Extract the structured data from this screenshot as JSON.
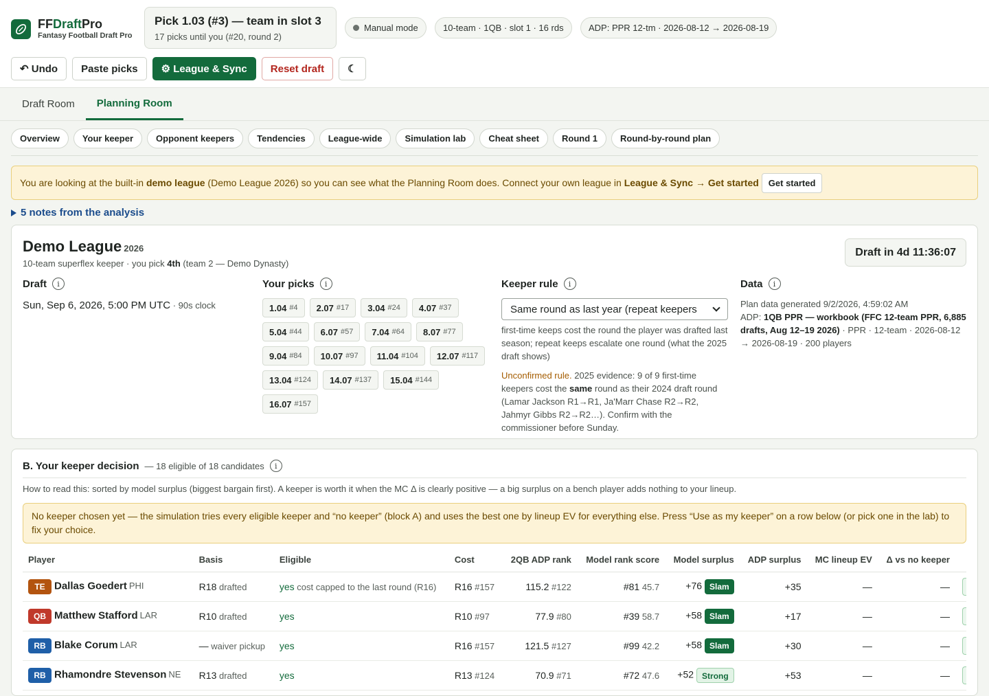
{
  "brand": {
    "name_a": "FF",
    "name_b": "Draft",
    "name_c": "Pro",
    "subtitle": "Fantasy Football Draft Pro"
  },
  "pick": {
    "title": "Pick 1.03 (#3) — team in slot 3",
    "subtitle": "17 picks until you (#20, round 2)"
  },
  "chips": {
    "mode": "Manual mode",
    "league": "10-team · 1QB · slot 1 · 16 rds",
    "adp": "ADP: PPR 12-tm · 2026-08-12 → 2026-08-19"
  },
  "toolbar": {
    "undo": "↶ Undo",
    "paste": "Paste picks",
    "league_sync": "⚙ League & Sync",
    "reset": "Reset draft",
    "theme": "☾"
  },
  "tabs": [
    "Draft Room",
    "Planning Room"
  ],
  "subtabs": [
    "Overview",
    "Your keeper",
    "Opponent keepers",
    "Tendencies",
    "League-wide",
    "Simulation lab",
    "Cheat sheet",
    "Round 1",
    "Round-by-round plan"
  ],
  "banner": {
    "t1": "You are looking at the built-in ",
    "b1": "demo league",
    "t2": " (Demo League 2026) so you can see what the Planning Room does. Connect your own league in ",
    "b2": "League & Sync",
    "t3": " → ",
    "b3": "Get started",
    "button": "Get started"
  },
  "notes": "5 notes from the analysis",
  "league": {
    "title": "Demo League",
    "year": "2026",
    "sub_a": "10-team superflex keeper · you pick ",
    "sub_b": "4th",
    "sub_c": " (team 2 — Demo Dynasty)",
    "countdown": "Draft in 4d 11:36:07",
    "draft_label": "Draft",
    "draft_date": "Sun, Sep 6, 2026, 5:00 PM UTC",
    "draft_clock": " · 90s clock",
    "picks_label": "Your picks",
    "picks": [
      {
        "p": "1.04",
        "n": "#4"
      },
      {
        "p": "2.07",
        "n": "#17"
      },
      {
        "p": "3.04",
        "n": "#24"
      },
      {
        "p": "4.07",
        "n": "#37"
      },
      {
        "p": "5.04",
        "n": "#44"
      },
      {
        "p": "6.07",
        "n": "#57"
      },
      {
        "p": "7.04",
        "n": "#64"
      },
      {
        "p": "8.07",
        "n": "#77"
      },
      {
        "p": "9.04",
        "n": "#84"
      },
      {
        "p": "10.07",
        "n": "#97"
      },
      {
        "p": "11.04",
        "n": "#104"
      },
      {
        "p": "12.07",
        "n": "#117"
      },
      {
        "p": "13.04",
        "n": "#124"
      },
      {
        "p": "14.07",
        "n": "#137"
      },
      {
        "p": "15.04",
        "n": "#144"
      },
      {
        "p": "16.07",
        "n": "#157"
      }
    ],
    "keeper_label": "Keeper rule",
    "keeper_select": "Same round as last year (repeat keepers",
    "keeper_desc": "first-time keeps cost the round the player was drafted last season; repeat keeps escalate one round (what the 2025 draft shows)",
    "unconf_a": "Unconfirmed rule.",
    "unconf_b": " 2025 evidence: 9 of 9 first-time keepers cost the ",
    "unconf_c": "same",
    "unconf_d": " round as their 2024 draft round (Lamar Jackson R1→R1, Ja'Marr Chase R2→R2, Jahmyr Gibbs R2→R2…). Confirm with the commissioner before Sunday.",
    "data_label": "Data",
    "data_a": "Plan data generated 9/2/2026, 4:59:02 AM",
    "data_b": "ADP: ",
    "data_c": "1QB PPR — workbook (FFC 12-team PPR, 6,885 drafts, Aug 12–19 2026)",
    "data_d": " · PPR · 12-team · 2026-08-12 → 2026-08-19 · 200 players"
  },
  "keeper": {
    "title": "B. Your keeper decision",
    "count": "— 18 eligible of 18 candidates",
    "howto": "How to read this: sorted by model surplus (biggest bargain first). A keeper is worth it when the MC Δ is clearly positive — a big surplus on a bench player adds nothing to your lineup.",
    "warn": "No keeper chosen yet — the simulation tries every eligible keeper and “no keeper” (block A) and uses the best one by lineup EV for everything else. Press “Use as my keeper” on a row below (or pick one in the lab) to fix your choice.",
    "headers": [
      "Player",
      "Basis",
      "Eligible",
      "Cost",
      "2QB ADP rank",
      "Model rank score",
      "Model surplus",
      "ADP surplus",
      "MC lineup EV",
      "Δ vs no keeper"
    ],
    "rows": [
      {
        "pos": "TE",
        "color": "#b3540f",
        "name": "Dallas Goedert",
        "team": "PHI",
        "basis": "R18",
        "basis_s": " drafted",
        "elig": "yes",
        "elig_s": " cost capped to the last round (R16)",
        "cost": "R16",
        "cost_s": " #157",
        "adp": "115.2",
        "adp_s": " #122",
        "mrank": "#81",
        "mrank_s": " 45.7",
        "surplus": "+76",
        "tag": "Slam",
        "tagc": "slam",
        "adps": "+35",
        "ev": "—",
        "delta": "—"
      },
      {
        "pos": "QB",
        "color": "#c0392b",
        "name": "Matthew Stafford",
        "team": "LAR",
        "basis": "R10",
        "basis_s": " drafted",
        "elig": "yes",
        "elig_s": "",
        "cost": "R10",
        "cost_s": " #97",
        "adp": "77.9",
        "adp_s": " #80",
        "mrank": "#39",
        "mrank_s": " 58.7",
        "surplus": "+58",
        "tag": "Slam",
        "tagc": "slam",
        "adps": "+17",
        "ev": "—",
        "delta": "—"
      },
      {
        "pos": "RB",
        "color": "#1f5fa8",
        "name": "Blake Corum",
        "team": "LAR",
        "basis": "—",
        "basis_s": " waiver pickup",
        "elig": "yes",
        "elig_s": "",
        "cost": "R16",
        "cost_s": " #157",
        "adp": "121.5",
        "adp_s": " #127",
        "mrank": "#99",
        "mrank_s": " 42.2",
        "surplus": "+58",
        "tag": "Slam",
        "tagc": "slam",
        "adps": "+30",
        "ev": "—",
        "delta": "—"
      },
      {
        "pos": "RB",
        "color": "#1f5fa8",
        "name": "Rhamondre Stevenson",
        "team": "NE",
        "basis": "R13",
        "basis_s": " drafted",
        "elig": "yes",
        "elig_s": "",
        "cost": "R13",
        "cost_s": " #124",
        "adp": "70.9",
        "adp_s": " #71",
        "mrank": "#72",
        "mrank_s": " 47.6",
        "surplus": "+52",
        "tag": "Strong",
        "tagc": "strong",
        "adps": "+53",
        "ev": "—",
        "delta": "—"
      }
    ]
  }
}
